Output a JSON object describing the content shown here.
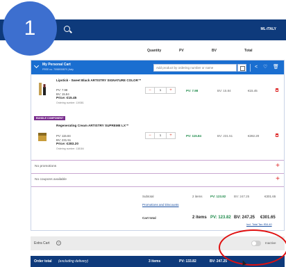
{
  "step_badge": "1",
  "topbar": {
    "locale": "ML-ITALY",
    "search_icon": "search-icon"
  },
  "columns": {
    "quantity": "Quantity",
    "pv": "PV",
    "bv": "BV",
    "total": "Total"
  },
  "cart": {
    "title": "My Personal Cart",
    "subtitle": "FREE no. 7098930879 | Italy",
    "add_placeholder": "Add product by ordering number or name",
    "items": [
      {
        "badge": "",
        "name": "Lipstick - Sweet Black ARTISTRY SIGNATURE COLOR™",
        "pv": "PV: 7.98",
        "bv": "BV: 15.84",
        "price": "Price: €15.45",
        "ordering": "Ordering number: 119381",
        "qty": "1",
        "col_pv": "PV: 7.98",
        "col_bv": "BV: 15.84",
        "col_total": "€15.45",
        "thumb_color": "#c4a055"
      },
      {
        "badge": "BUNDLE COMPONENT",
        "name": "Regenerating Cream ARTISTRY SUPREME LX™",
        "pv": "PV: 115.84",
        "bv": "BV: 231.51",
        "price": "Price: €283.20",
        "ordering": "Ordering number: 118184",
        "qty": "1",
        "col_pv": "PV: 115.84",
        "col_bv": "BV: 231.51",
        "col_total": "€282.20",
        "thumb_color": "#c89c3a"
      }
    ],
    "promotions_label": "No promotions",
    "coupons_label": "No coupons available",
    "subtotal": {
      "label": "Subtotal",
      "items": "2 items",
      "pv": "PV: 123.82",
      "bv": "BV: 247.25",
      "total": "€301.65"
    },
    "promotions_link": "Promotions and Discounts",
    "cart_total": {
      "label": "Cart total",
      "items": "2 items",
      "pv": "PV: 123.82",
      "bv": "BV: 247.25",
      "total": "€301.65"
    },
    "tax_note": "Incl. Total Tax: €54.40"
  },
  "extra_cart": {
    "label": "Extra Cart",
    "state": "Inactive"
  },
  "order_total": {
    "label": "Order total",
    "note": "(excluding delivery)",
    "items": "3 items",
    "pv": "PV: 133.82",
    "bv": "BV: 247.25"
  },
  "colors": {
    "nav": "#0e3a7b",
    "cart_header": "#1a6ed0",
    "pv_green": "#1e8a4a",
    "accent_red": "#d22",
    "bundle_purple": "#7a2e8e"
  }
}
